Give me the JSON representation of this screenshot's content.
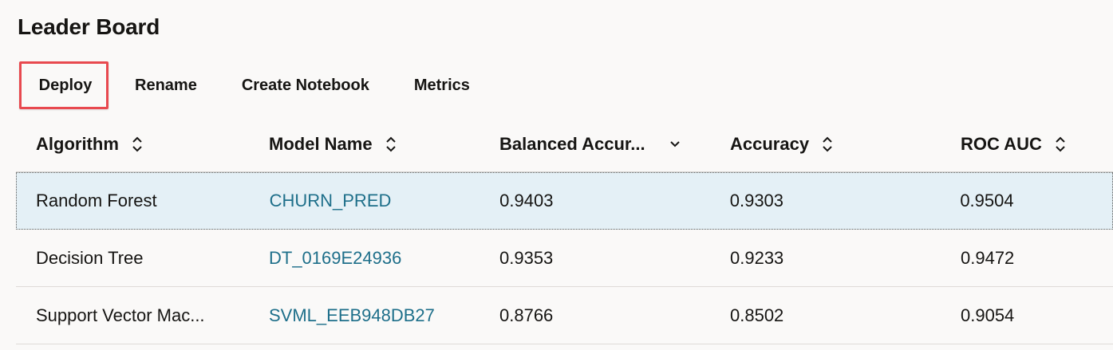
{
  "page": {
    "title": "Leader Board"
  },
  "toolbar": {
    "deploy_label": "Deploy",
    "rename_label": "Rename",
    "create_notebook_label": "Create Notebook",
    "metrics_label": "Metrics"
  },
  "table": {
    "columns": [
      {
        "label": "Algorithm",
        "sort_icon": "sort-both-icon"
      },
      {
        "label": "Model Name",
        "sort_icon": "sort-both-icon"
      },
      {
        "label": "Balanced Accur...",
        "sort_icon": "sort-descending-icon"
      },
      {
        "label": "Accuracy",
        "sort_icon": "sort-both-icon"
      },
      {
        "label": "ROC AUC",
        "sort_icon": "sort-both-icon"
      }
    ],
    "rows": [
      {
        "algorithm": "Random Forest",
        "model_name": "CHURN_PRED",
        "balanced_accuracy": "0.9403",
        "accuracy": "0.9303",
        "roc_auc": "0.9504",
        "selected": true
      },
      {
        "algorithm": "Decision Tree",
        "model_name": "DT_0169E24936",
        "balanced_accuracy": "0.9353",
        "accuracy": "0.9233",
        "roc_auc": "0.9472",
        "selected": false
      },
      {
        "algorithm": "Support Vector Mac...",
        "model_name": "SVML_EEB948DB27",
        "balanced_accuracy": "0.8766",
        "accuracy": "0.8502",
        "roc_auc": "0.9054",
        "selected": false
      }
    ]
  },
  "colors": {
    "background": "#faf9f8",
    "selected_row": "#e4f0f6",
    "link": "#1e6f8a",
    "highlight_border": "#e8494f",
    "text": "#161513"
  }
}
